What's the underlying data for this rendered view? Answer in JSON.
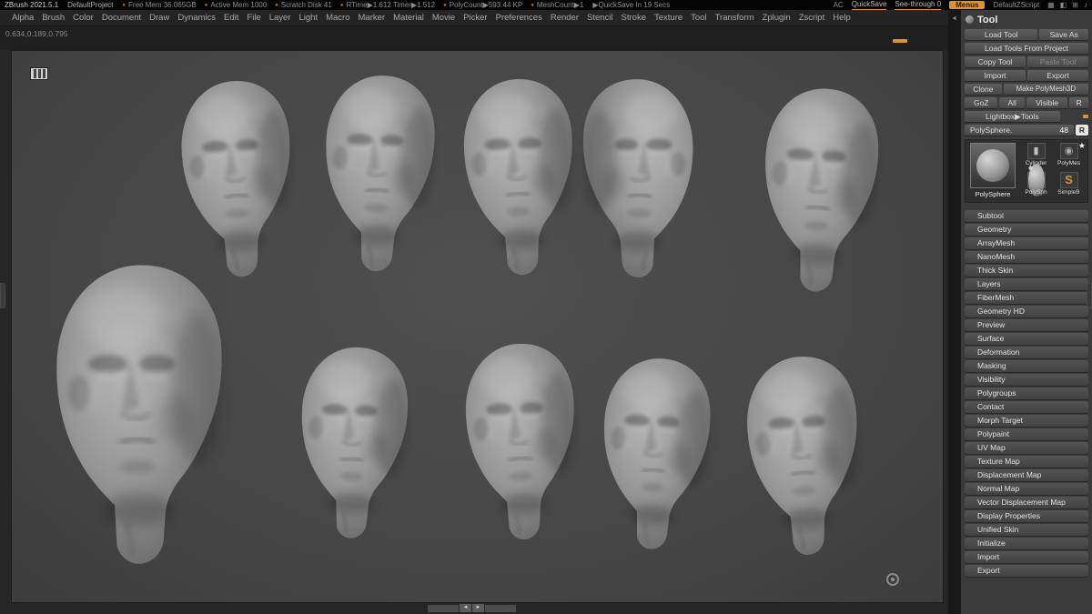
{
  "title_bar": {
    "app_title": "ZBrush 2021.5.1",
    "project": "DefaultProject",
    "stats": [
      "Free Mem 36.065GB",
      "Active Mem 1000",
      "Scratch Disk 41",
      "RTime▶1.612 Timer▶1.512",
      "PolyCount▶593.44 KP",
      "MeshCount▶1"
    ],
    "quicksave_countdown": "▶QuickSave In 19 Secs",
    "ac_label": "AC",
    "quicksave_label": "QuickSave",
    "see_through_label": "See-through 0",
    "menus_label": "Menus",
    "zscript_label": "DefaultZScript",
    "icons": [
      "▦",
      "◧",
      "⊞",
      "♪"
    ]
  },
  "menu_bar": {
    "items": [
      "Alpha",
      "Brush",
      "Color",
      "Document",
      "Draw",
      "Dynamics",
      "Edit",
      "File",
      "Layer",
      "Light",
      "Macro",
      "Marker",
      "Material",
      "Movie",
      "Picker",
      "Preferences",
      "Render",
      "Stencil",
      "Stroke",
      "Texture",
      "Tool",
      "Transform",
      "Zplugin",
      "Zscript",
      "Help"
    ]
  },
  "canvas": {
    "coordinates": "0.634,0.189,0.795"
  },
  "tool_panel": {
    "title": "Tool",
    "load_tool": "Load Tool",
    "save_as": "Save As",
    "load_tools_from_project": "Load Tools From Project",
    "copy_tool": "Copy Tool",
    "paste_tool": "Paste Tool",
    "import": "Import",
    "export": "Export",
    "clone": "Clone",
    "make_polymesh3d": "Make PolyMesh3D",
    "goz": "GoZ",
    "all": "All",
    "visible": "Visible",
    "r": "R",
    "lightbox_tools": "Lightbox▶Tools",
    "current_tool_name": "PolySphere.",
    "current_tool_value": "48",
    "thumbnails": {
      "selected_label": "PolySphere",
      "items": [
        {
          "label": "Cylinder",
          "glyph": "▮",
          "kind": "cylinder"
        },
        {
          "label": "PolyMes",
          "glyph": "◉",
          "kind": "mesh"
        },
        {
          "label": "PolySph",
          "glyph": "●",
          "kind": "sphere"
        },
        {
          "label": "SimpleB",
          "glyph": "S",
          "kind": "simplebrush"
        }
      ]
    },
    "subpalettes": [
      "Subtool",
      "Geometry",
      "ArrayMesh",
      "NanoMesh",
      "Thick Skin",
      "Layers",
      "FiberMesh",
      "Geometry HD",
      "Preview",
      "Surface",
      "Deformation",
      "Masking",
      "Visibility",
      "Polygroups",
      "Contact",
      "Morph Target",
      "Polypaint",
      "UV Map",
      "Texture Map",
      "Displacement Map",
      "Normal Map",
      "Vector Displacement Map",
      "Display Properties",
      "Unified Skin",
      "Initialize",
      "Import",
      "Export"
    ]
  },
  "icons": {
    "status_dot": "●",
    "collapse_arrow": "◄",
    "star": "★",
    "scroll_left": "◄",
    "scroll_right": "►"
  },
  "colors": {
    "accent_orange": "#e0922f"
  }
}
